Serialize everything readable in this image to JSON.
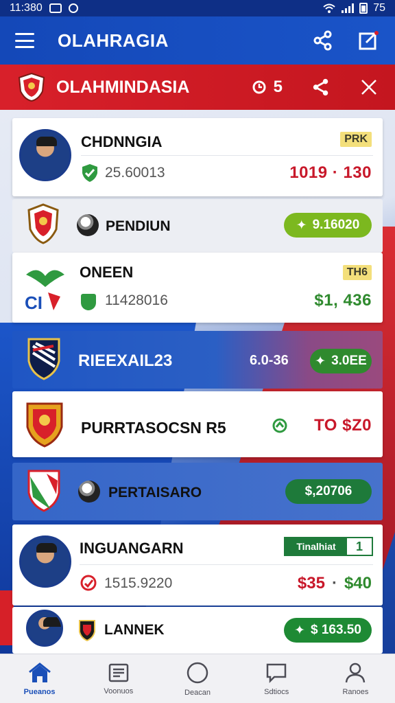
{
  "status_bar": {
    "time": "11:380",
    "battery_text": "75"
  },
  "app_bar": {
    "title": "OLAHRAGIA"
  },
  "banner": {
    "title": "OLAHMINDASIA",
    "count": "5"
  },
  "cards": [
    {
      "name": "CHDNNGIA",
      "number": "25.60013",
      "badge": "PRK",
      "price": "1019 · 130"
    },
    {
      "name": "PENDIUN",
      "pill": "9.16020"
    },
    {
      "name": "ONEEN",
      "number": "11428016",
      "badge": "TH6",
      "price": "$1, 436",
      "logo_text": "CI"
    },
    {
      "name": "RIEEXAIL23",
      "odds": "6.0-36",
      "pill": "3.0EE"
    },
    {
      "name": "PURRTASOCSN R5",
      "price": "TO $Z0"
    },
    {
      "name": "PERTAISARO",
      "pill": "$,20706"
    },
    {
      "name": "INGUANGARN",
      "number": "1515.9220",
      "badge": "Tinalhiat",
      "badge_count": "1",
      "price_a": "$35",
      "price_sep": "·",
      "price_b": "$40"
    },
    {
      "name": "LANNEK",
      "pill": "$ 163.50"
    }
  ],
  "nav": [
    {
      "label": "Pueanos",
      "icon": "home-icon",
      "active": true
    },
    {
      "label": "Voonuos",
      "icon": "news-icon",
      "active": false
    },
    {
      "label": "Deacan",
      "icon": "circle-icon",
      "active": false
    },
    {
      "label": "Sdtiocs",
      "icon": "chat-icon",
      "active": false
    },
    {
      "label": "Ranoes",
      "icon": "profile-icon",
      "active": false
    }
  ],
  "colors": {
    "primary": "#1a4fb8",
    "red": "#d8202a",
    "green": "#2f8a2e",
    "lime": "#7cb81f",
    "dark_green": "#1e7a3a"
  }
}
